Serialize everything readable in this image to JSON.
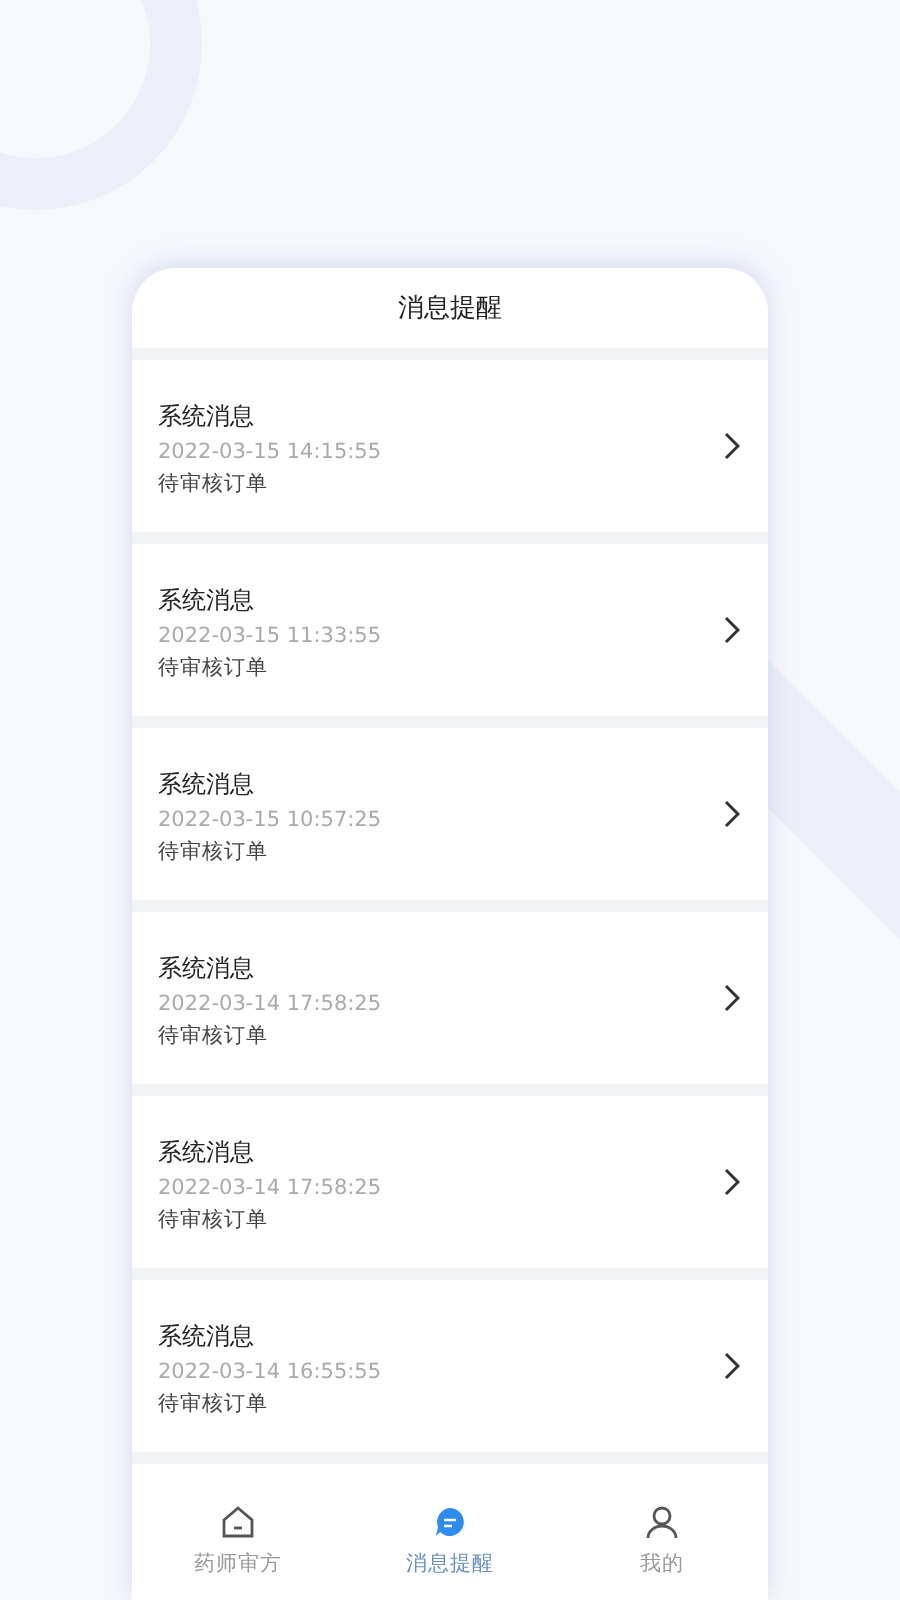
{
  "header": {
    "title": "消息提醒"
  },
  "messages": [
    {
      "title": "系统消息",
      "time": "2022-03-15 14:15:55",
      "body": "待审核订单"
    },
    {
      "title": "系统消息",
      "time": "2022-03-15 11:33:55",
      "body": "待审核订单"
    },
    {
      "title": "系统消息",
      "time": "2022-03-15 10:57:25",
      "body": "待审核订单"
    },
    {
      "title": "系统消息",
      "time": "2022-03-14 17:58:25",
      "body": "待审核订单"
    },
    {
      "title": "系统消息",
      "time": "2022-03-14 17:58:25",
      "body": "待审核订单"
    },
    {
      "title": "系统消息",
      "time": "2022-03-14 16:55:55",
      "body": "待审核订单"
    }
  ],
  "tab_bar": [
    {
      "kind": "home",
      "label": "药师审方",
      "selected": false
    },
    {
      "kind": "chat",
      "label": "消息提醒",
      "selected": true
    },
    {
      "kind": "user",
      "label": "我的",
      "selected": false
    }
  ]
}
